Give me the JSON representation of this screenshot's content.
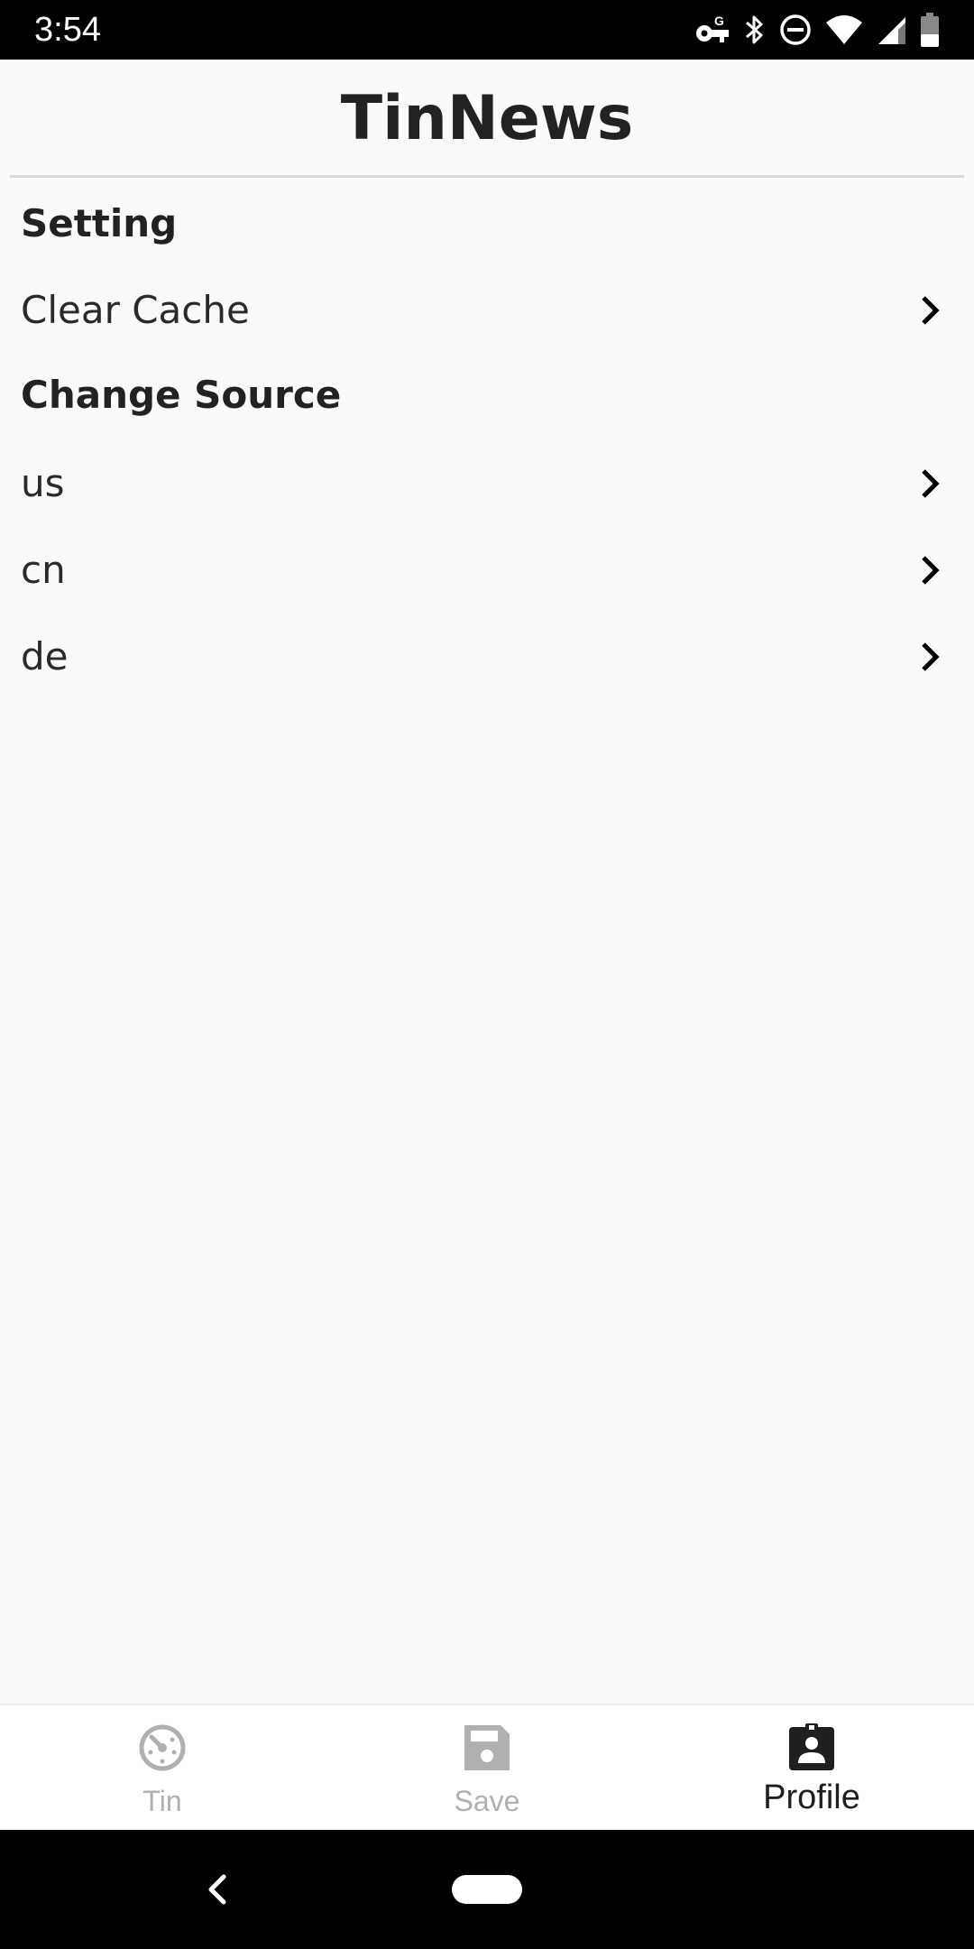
{
  "status_bar": {
    "time": "3:54",
    "icons": [
      "vpn-key-icon",
      "bluetooth-icon",
      "do-not-disturb-icon",
      "wifi-icon",
      "signal-icon",
      "battery-icon"
    ]
  },
  "app_bar": {
    "title": "TinNews"
  },
  "settings": {
    "setting_header": "Setting",
    "clear_cache_label": "Clear Cache",
    "change_source_header": "Change Source",
    "sources": [
      "us",
      "cn",
      "de"
    ]
  },
  "bottom_nav": {
    "items": [
      {
        "label": "Tin",
        "icon": "tin-icon",
        "active": false
      },
      {
        "label": "Save",
        "icon": "save-icon",
        "active": false
      },
      {
        "label": "Profile",
        "icon": "profile-icon",
        "active": true
      }
    ]
  },
  "system_nav": {
    "icons": [
      "back-icon",
      "home-pill-icon"
    ]
  },
  "colors": {
    "background": "#fafafa",
    "text": "#222222",
    "nav_inactive": "#b0b0b0",
    "nav_active": "#1f1f1f",
    "status_bar": "#000000"
  }
}
